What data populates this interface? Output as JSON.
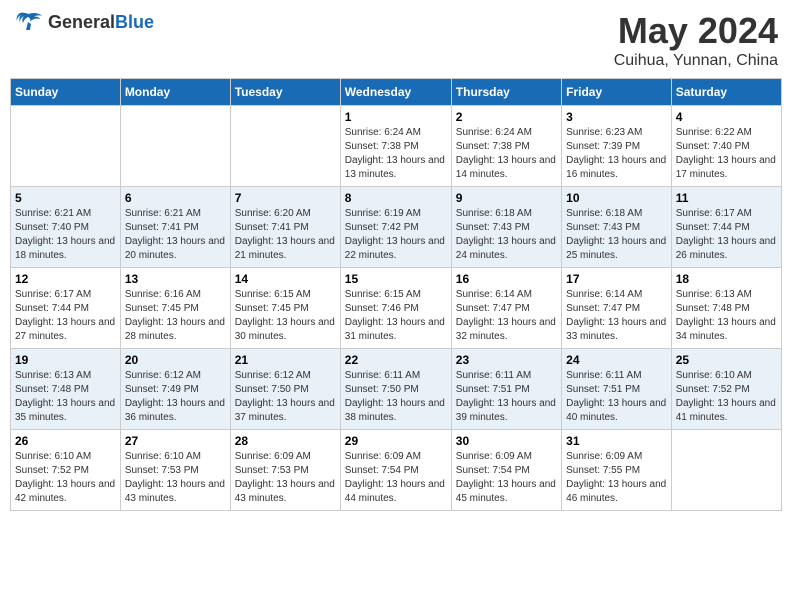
{
  "header": {
    "logo_general": "General",
    "logo_blue": "Blue",
    "month_title": "May 2024",
    "location": "Cuihua, Yunnan, China"
  },
  "days_of_week": [
    "Sunday",
    "Monday",
    "Tuesday",
    "Wednesday",
    "Thursday",
    "Friday",
    "Saturday"
  ],
  "weeks": [
    [
      {
        "day": "",
        "info": ""
      },
      {
        "day": "",
        "info": ""
      },
      {
        "day": "",
        "info": ""
      },
      {
        "day": "1",
        "info": "Sunrise: 6:24 AM\nSunset: 7:38 PM\nDaylight: 13 hours and 13 minutes."
      },
      {
        "day": "2",
        "info": "Sunrise: 6:24 AM\nSunset: 7:38 PM\nDaylight: 13 hours and 14 minutes."
      },
      {
        "day": "3",
        "info": "Sunrise: 6:23 AM\nSunset: 7:39 PM\nDaylight: 13 hours and 16 minutes."
      },
      {
        "day": "4",
        "info": "Sunrise: 6:22 AM\nSunset: 7:40 PM\nDaylight: 13 hours and 17 minutes."
      }
    ],
    [
      {
        "day": "5",
        "info": "Sunrise: 6:21 AM\nSunset: 7:40 PM\nDaylight: 13 hours and 18 minutes."
      },
      {
        "day": "6",
        "info": "Sunrise: 6:21 AM\nSunset: 7:41 PM\nDaylight: 13 hours and 20 minutes."
      },
      {
        "day": "7",
        "info": "Sunrise: 6:20 AM\nSunset: 7:41 PM\nDaylight: 13 hours and 21 minutes."
      },
      {
        "day": "8",
        "info": "Sunrise: 6:19 AM\nSunset: 7:42 PM\nDaylight: 13 hours and 22 minutes."
      },
      {
        "day": "9",
        "info": "Sunrise: 6:18 AM\nSunset: 7:43 PM\nDaylight: 13 hours and 24 minutes."
      },
      {
        "day": "10",
        "info": "Sunrise: 6:18 AM\nSunset: 7:43 PM\nDaylight: 13 hours and 25 minutes."
      },
      {
        "day": "11",
        "info": "Sunrise: 6:17 AM\nSunset: 7:44 PM\nDaylight: 13 hours and 26 minutes."
      }
    ],
    [
      {
        "day": "12",
        "info": "Sunrise: 6:17 AM\nSunset: 7:44 PM\nDaylight: 13 hours and 27 minutes."
      },
      {
        "day": "13",
        "info": "Sunrise: 6:16 AM\nSunset: 7:45 PM\nDaylight: 13 hours and 28 minutes."
      },
      {
        "day": "14",
        "info": "Sunrise: 6:15 AM\nSunset: 7:45 PM\nDaylight: 13 hours and 30 minutes."
      },
      {
        "day": "15",
        "info": "Sunrise: 6:15 AM\nSunset: 7:46 PM\nDaylight: 13 hours and 31 minutes."
      },
      {
        "day": "16",
        "info": "Sunrise: 6:14 AM\nSunset: 7:47 PM\nDaylight: 13 hours and 32 minutes."
      },
      {
        "day": "17",
        "info": "Sunrise: 6:14 AM\nSunset: 7:47 PM\nDaylight: 13 hours and 33 minutes."
      },
      {
        "day": "18",
        "info": "Sunrise: 6:13 AM\nSunset: 7:48 PM\nDaylight: 13 hours and 34 minutes."
      }
    ],
    [
      {
        "day": "19",
        "info": "Sunrise: 6:13 AM\nSunset: 7:48 PM\nDaylight: 13 hours and 35 minutes."
      },
      {
        "day": "20",
        "info": "Sunrise: 6:12 AM\nSunset: 7:49 PM\nDaylight: 13 hours and 36 minutes."
      },
      {
        "day": "21",
        "info": "Sunrise: 6:12 AM\nSunset: 7:50 PM\nDaylight: 13 hours and 37 minutes."
      },
      {
        "day": "22",
        "info": "Sunrise: 6:11 AM\nSunset: 7:50 PM\nDaylight: 13 hours and 38 minutes."
      },
      {
        "day": "23",
        "info": "Sunrise: 6:11 AM\nSunset: 7:51 PM\nDaylight: 13 hours and 39 minutes."
      },
      {
        "day": "24",
        "info": "Sunrise: 6:11 AM\nSunset: 7:51 PM\nDaylight: 13 hours and 40 minutes."
      },
      {
        "day": "25",
        "info": "Sunrise: 6:10 AM\nSunset: 7:52 PM\nDaylight: 13 hours and 41 minutes."
      }
    ],
    [
      {
        "day": "26",
        "info": "Sunrise: 6:10 AM\nSunset: 7:52 PM\nDaylight: 13 hours and 42 minutes."
      },
      {
        "day": "27",
        "info": "Sunrise: 6:10 AM\nSunset: 7:53 PM\nDaylight: 13 hours and 43 minutes."
      },
      {
        "day": "28",
        "info": "Sunrise: 6:09 AM\nSunset: 7:53 PM\nDaylight: 13 hours and 43 minutes."
      },
      {
        "day": "29",
        "info": "Sunrise: 6:09 AM\nSunset: 7:54 PM\nDaylight: 13 hours and 44 minutes."
      },
      {
        "day": "30",
        "info": "Sunrise: 6:09 AM\nSunset: 7:54 PM\nDaylight: 13 hours and 45 minutes."
      },
      {
        "day": "31",
        "info": "Sunrise: 6:09 AM\nSunset: 7:55 PM\nDaylight: 13 hours and 46 minutes."
      },
      {
        "day": "",
        "info": ""
      }
    ]
  ]
}
